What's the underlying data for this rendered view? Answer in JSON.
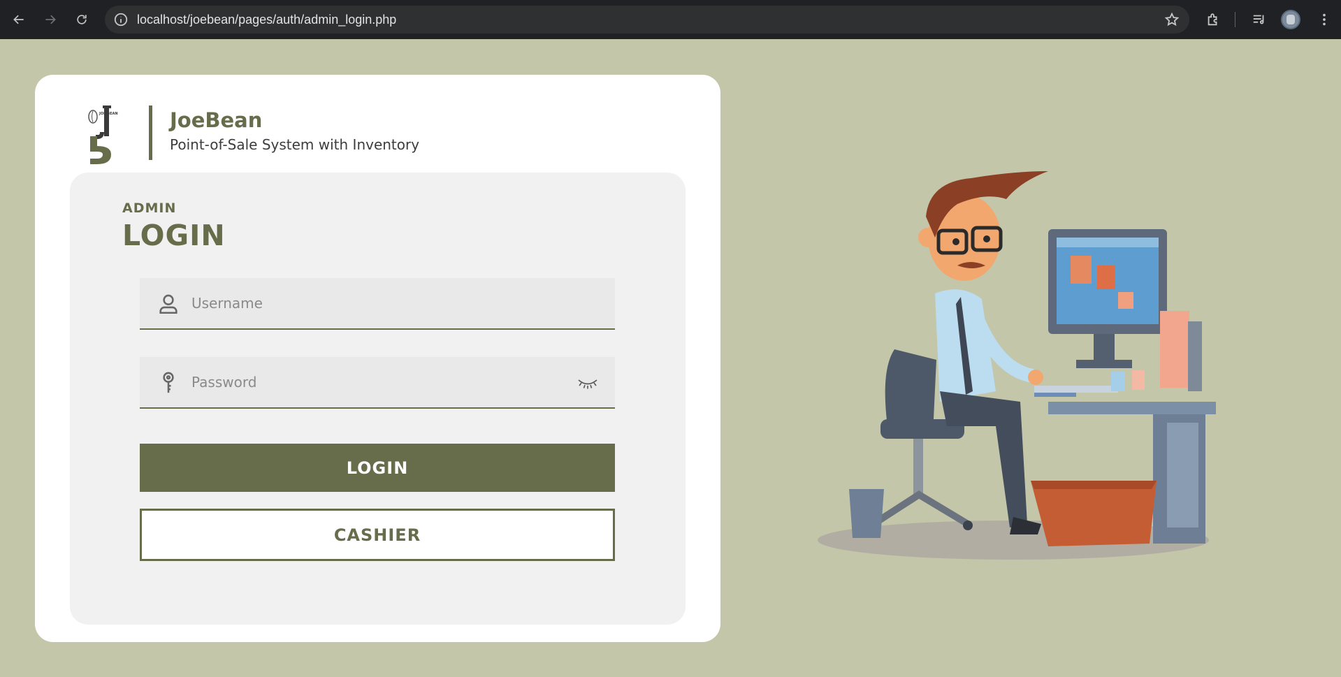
{
  "browser": {
    "url": "localhost/joebean/pages/auth/admin_login.php",
    "icons": [
      "back-icon",
      "forward-icon",
      "reload-icon",
      "site-info-icon",
      "bookmark-star-icon",
      "extensions-icon",
      "media-controls-icon",
      "profile-avatar",
      "menu-kebab-icon"
    ]
  },
  "brand": {
    "name": "JoeBean",
    "tagline": "Point-of-Sale System with Inventory",
    "logo_text": "JOE BEAN"
  },
  "login": {
    "kicker": "ADMIN",
    "title": "LOGIN",
    "username_placeholder": "Username",
    "password_placeholder": "Password",
    "login_button": "LOGIN",
    "cashier_button": "CASHIER"
  },
  "colors": {
    "background": "#c3c6a9",
    "accent": "#676d4b",
    "card": "#ffffff",
    "panel": "#f1f1f1"
  }
}
